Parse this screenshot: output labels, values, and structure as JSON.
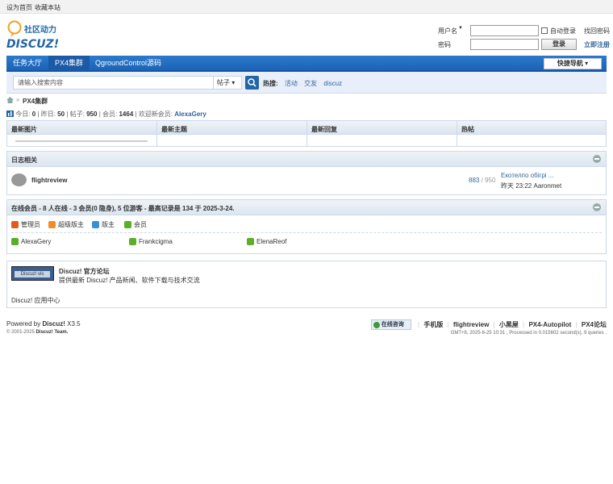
{
  "topbar": {
    "set_home": "设为首页",
    "bookmark": "收藏本站"
  },
  "logo": {
    "text": "社区动力",
    "brand": "DISCUZ!"
  },
  "login": {
    "username_label": "用户名",
    "password_label": "密码",
    "auto_login": "自动登录",
    "login_button": "登录",
    "find_password": "找回密码",
    "register": "立即注册"
  },
  "nav": {
    "items": [
      "任务大厅",
      "PX4集群",
      "QgroundControl源码"
    ],
    "active_index": 1,
    "quick_nav": "快捷导航"
  },
  "search": {
    "placeholder": "请输入搜索内容",
    "type": "帖子",
    "hot_label": "热搜:",
    "hot_terms": [
      "活动",
      "交友",
      "discuz"
    ]
  },
  "breadcrumb": {
    "sep": "»",
    "current": "PX4集群"
  },
  "stats": {
    "today_label": "今日:",
    "today": "0",
    "yesterday_label": "昨日:",
    "yesterday": "50",
    "posts_label": "帖子:",
    "posts": "950",
    "members_label": "会员:",
    "members": "1464",
    "welcome_label": "欢迎新会员:",
    "new_member": "AlexaGery",
    "sep": "|"
  },
  "grid4": {
    "headers": [
      "最新图片",
      "最新主题",
      "最新回复",
      "热帖"
    ]
  },
  "forum_section": {
    "title": "日志相关",
    "forum": {
      "name": "flightreview",
      "threads": "883",
      "sep": "/",
      "posts": "950",
      "last_title": "Екотелпо обігрі ...",
      "last_time": "昨天 23:22",
      "last_author": "Aaronmet"
    }
  },
  "online": {
    "title": "在线会员 - 8 人在线 - 3 会员(0 隐身), 5 位游客 - 最高记录是 134 于 2025-3-24.",
    "legend": [
      {
        "label": "管理员",
        "color": "#e25a1c"
      },
      {
        "label": "超级版主",
        "color": "#f08c2a"
      },
      {
        "label": "版主",
        "color": "#3b8ed6"
      },
      {
        "label": "会员",
        "color": "#5aae2a"
      }
    ],
    "users": [
      "AlexaGery",
      "Frankcigma",
      "ElenaReof"
    ],
    "user_color": "#5aae2a"
  },
  "friend": {
    "logo_text": "Discuz! vis",
    "title": "Discuz! 官方论坛",
    "desc": "提供最新 Discuz! 产品新闻、软件下载与技术交流",
    "app_center": "Discuz! 应用中心"
  },
  "footer": {
    "powered_label": "Powered by",
    "powered_brand": "Discuz!",
    "version": "X3.5",
    "copyright": "© 2001-2025",
    "team": "Discuz! Team.",
    "chat_label": "在线咨询",
    "links": [
      "手机版",
      "flightreview",
      "小黑屋",
      "PX4-Autopilot",
      "PX4论坛"
    ],
    "time_info": "GMT+8, 2025-6-25 10:31 , Processed in 0.015602 second(s), 9 queries ."
  },
  "colors": {
    "accent": "#2b7acd",
    "link": "#336699",
    "header_bg": "#e8effa"
  }
}
